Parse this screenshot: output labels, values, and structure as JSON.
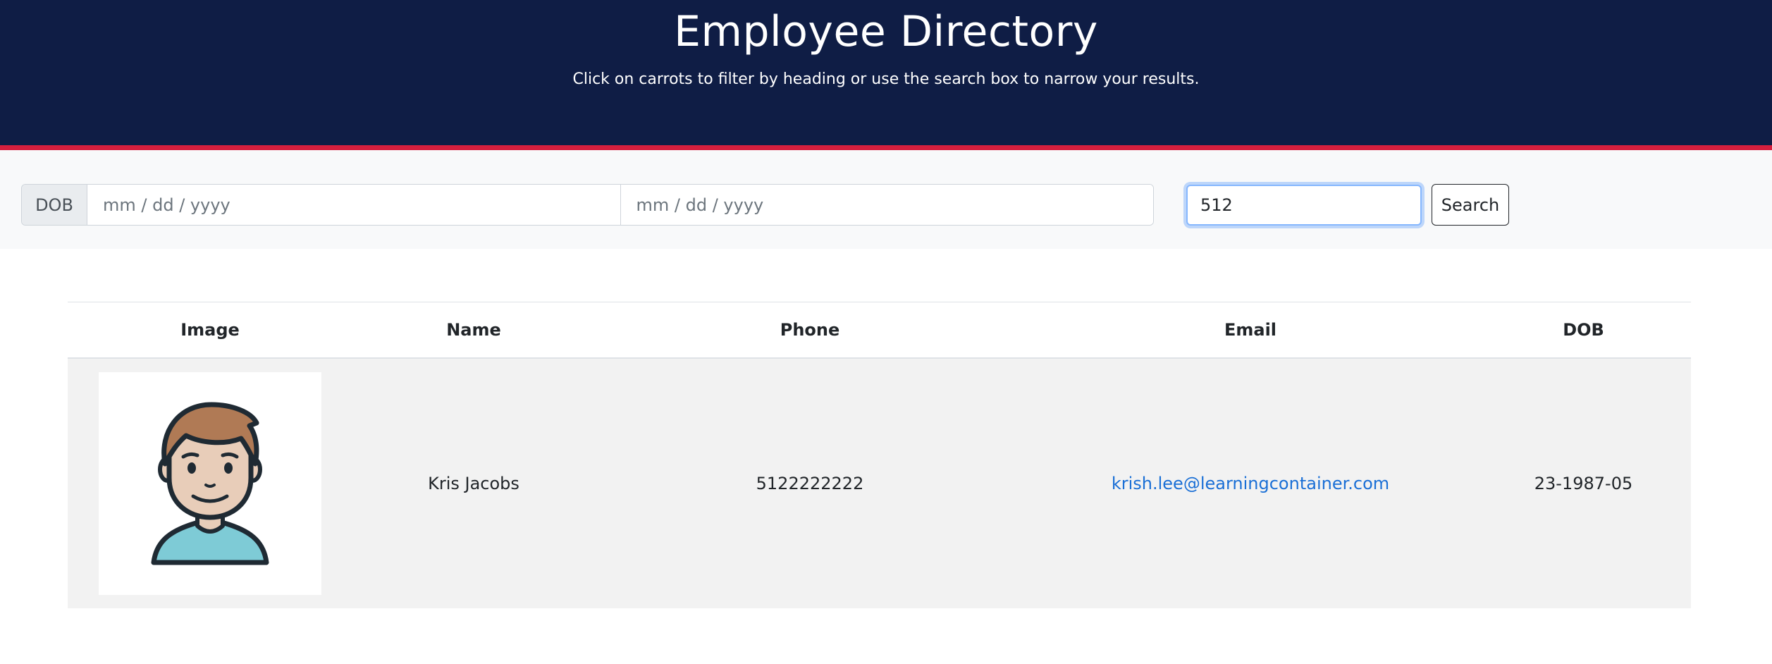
{
  "header": {
    "title": "Employee Directory",
    "subtitle": "Click on carrots to filter by heading or use the search box to narrow your results."
  },
  "filters": {
    "dob_label": "DOB",
    "start_date_placeholder": "mm / dd / yyyy",
    "end_date_placeholder": "mm / dd / yyyy",
    "search_value": "512",
    "search_button_label": "Search"
  },
  "table": {
    "columns": [
      "Image",
      "Name",
      "Phone",
      "Email",
      "DOB"
    ],
    "rows": [
      {
        "avatar_icon": "male-avatar-icon",
        "name": "Kris Jacobs",
        "phone": "5122222222",
        "email": "krish.lee@learningcontainer.com",
        "dob": "23-1987-05"
      }
    ]
  },
  "colors": {
    "header_bg": "#0f1d45",
    "accent_bar": "#d61f3e",
    "link": "#1a6fd6"
  }
}
